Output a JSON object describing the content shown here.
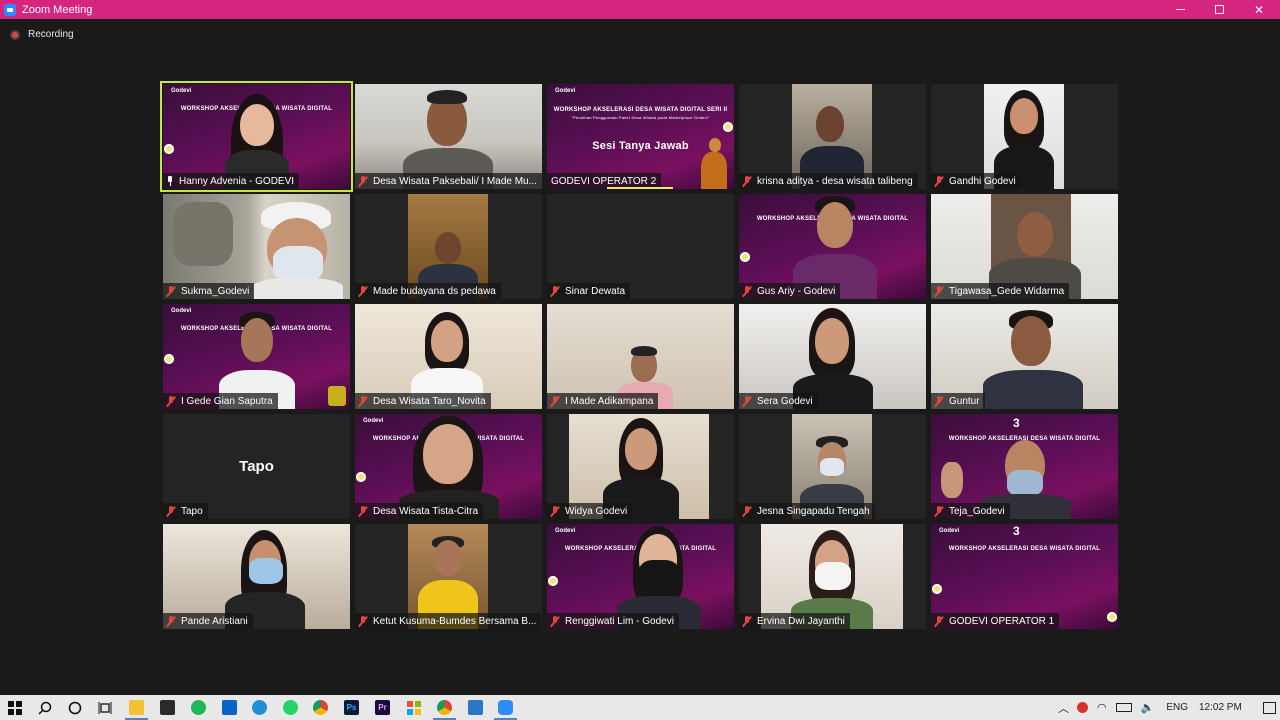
{
  "window": {
    "title": "Zoom Meeting"
  },
  "recording": {
    "label": "Recording"
  },
  "colors": {
    "titlebar": "#d6257f",
    "active_speaker": "#c5e83a",
    "muted": "#e0463e",
    "slide_bg": "#5a0f55"
  },
  "slides": {
    "brand": "Godevi",
    "workshop": "WORKSHOP AKSELERASI DESA WISATA DIGITAL",
    "workshop_series": "WORKSHOP AKSELERASI DESA WISATA DIGITAL SERI II",
    "subtitle": "\"Pelatihan Penggunaan Paket Desa Wisata pada Marketplace Godevi\"",
    "qa": "Sesi Tanya Jawab",
    "workshop_cut": "WORKSHOP AKS",
    "workshop_cut2": "WISATA DIGITAL",
    "number": "3"
  },
  "participants": [
    {
      "name": "Hanny Advenia - GODEVI",
      "status": "pinned"
    },
    {
      "name": "Desa Wisata Paksebali/ I Made Mu...",
      "status": "muted"
    },
    {
      "name": "GODEVI OPERATOR 2",
      "status": "none"
    },
    {
      "name": "krisna aditya - desa wisata talibeng",
      "status": "muted"
    },
    {
      "name": "Gandhi Godevi",
      "status": "muted"
    },
    {
      "name": "Sukma_Godevi",
      "status": "muted"
    },
    {
      "name": "Made budayana ds pedawa",
      "status": "muted"
    },
    {
      "name": "Sinar Dewata",
      "status": "muted"
    },
    {
      "name": "Gus Ariy - Godevi",
      "status": "muted"
    },
    {
      "name": "Tigawasa_Gede Widarma",
      "status": "muted"
    },
    {
      "name": "I Gede Gian Saputra",
      "status": "muted"
    },
    {
      "name": "Desa Wisata Taro_Novita",
      "status": "muted"
    },
    {
      "name": "I Made Adikampana",
      "status": "muted"
    },
    {
      "name": "Sera Godevi",
      "status": "muted"
    },
    {
      "name": "Guntur",
      "status": "muted"
    },
    {
      "name": "Tapo",
      "status": "muted",
      "display": "Tapo"
    },
    {
      "name": "Desa Wisata Tista-Citra",
      "status": "muted"
    },
    {
      "name": "Widya Godevi",
      "status": "muted"
    },
    {
      "name": "Jesna Singapadu Tengah",
      "status": "muted"
    },
    {
      "name": "Teja_Godevi",
      "status": "muted"
    },
    {
      "name": "Pande Aristiani",
      "status": "muted"
    },
    {
      "name": "Ketut Kusuma-Bumdes Bersama B...",
      "status": "muted"
    },
    {
      "name": "Renggiwati Lim - Godevi",
      "status": "muted"
    },
    {
      "name": "Ervina Dwi Jayanthi",
      "status": "muted"
    },
    {
      "name": "GODEVI OPERATOR 1",
      "status": "muted"
    }
  ],
  "taskbar": {
    "icons": [
      "windows-start",
      "search",
      "cortana",
      "task-view",
      "file-explorer",
      "store",
      "spotify",
      "mail",
      "edge",
      "whatsapp",
      "chrome",
      "photoshop",
      "premiere",
      "windows-store",
      "chrome-2",
      "photos",
      "zoom"
    ],
    "tray": {
      "language": "ENG",
      "time": "12:02 PM"
    }
  }
}
